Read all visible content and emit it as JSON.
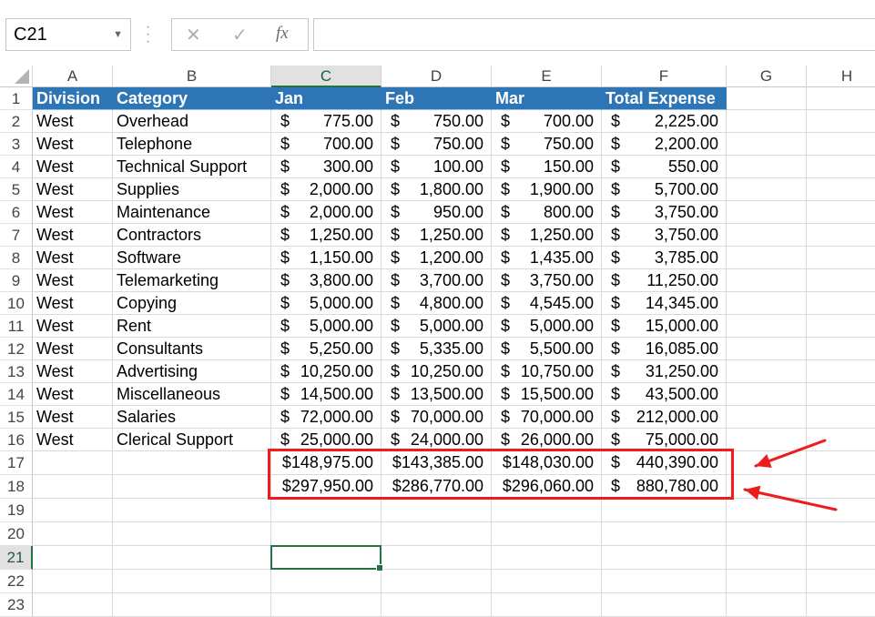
{
  "formula_bar": {
    "name_box": "C21",
    "cancel_icon": "✕",
    "enter_icon": "✓",
    "fx_label": "fx",
    "formula": ""
  },
  "columns": [
    "A",
    "B",
    "C",
    "D",
    "E",
    "F",
    "G",
    "H"
  ],
  "selected_column": "C",
  "selected_row": 21,
  "active_cell": "C21",
  "header_row": [
    "Division",
    "Category",
    "Jan",
    "Feb",
    "Mar",
    "Total Expense"
  ],
  "rows": [
    [
      "West",
      "Overhead",
      "775.00",
      "750.00",
      "700.00",
      "2,225.00"
    ],
    [
      "West",
      "Telephone",
      "700.00",
      "750.00",
      "750.00",
      "2,200.00"
    ],
    [
      "West",
      "Technical Support",
      "300.00",
      "100.00",
      "150.00",
      "550.00"
    ],
    [
      "West",
      "Supplies",
      "2,000.00",
      "1,800.00",
      "1,900.00",
      "5,700.00"
    ],
    [
      "West",
      "Maintenance",
      "2,000.00",
      "950.00",
      "800.00",
      "3,750.00"
    ],
    [
      "West",
      "Contractors",
      "1,250.00",
      "1,250.00",
      "1,250.00",
      "3,750.00"
    ],
    [
      "West",
      "Software",
      "1,150.00",
      "1,200.00",
      "1,435.00",
      "3,785.00"
    ],
    [
      "West",
      "Telemarketing",
      "3,800.00",
      "3,700.00",
      "3,750.00",
      "11,250.00"
    ],
    [
      "West",
      "Copying",
      "5,000.00",
      "4,800.00",
      "4,545.00",
      "14,345.00"
    ],
    [
      "West",
      "Rent",
      "5,000.00",
      "5,000.00",
      "5,000.00",
      "15,000.00"
    ],
    [
      "West",
      "Consultants",
      "5,250.00",
      "5,335.00",
      "5,500.00",
      "16,085.00"
    ],
    [
      "West",
      "Advertising",
      "10,250.00",
      "10,250.00",
      "10,750.00",
      "31,250.00"
    ],
    [
      "West",
      "Miscellaneous",
      "14,500.00",
      "13,500.00",
      "15,500.00",
      "43,500.00"
    ],
    [
      "West",
      "Salaries",
      "72,000.00",
      "70,000.00",
      "70,000.00",
      "212,000.00"
    ],
    [
      "West",
      "Clerical Support",
      "25,000.00",
      "24,000.00",
      "26,000.00",
      "75,000.00"
    ],
    [
      "",
      "",
      "148,975.00",
      "143,385.00",
      "148,030.00",
      "440,390.00"
    ],
    [
      "",
      "",
      "297,950.00",
      "286,770.00",
      "296,060.00",
      "880,780.00"
    ]
  ],
  "currency_symbol": "$",
  "highlight": {
    "color": "#ee1c1c",
    "rows": [
      17,
      18
    ],
    "columns": [
      "C",
      "F"
    ]
  },
  "colors": {
    "header_fill": "#2e75b6",
    "selection": "#217346"
  }
}
